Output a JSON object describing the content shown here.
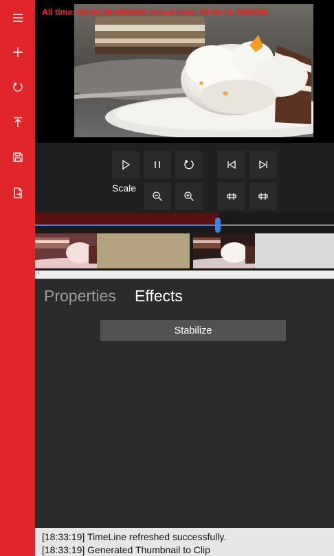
{
  "sidebar": {
    "items": [
      {
        "icon": "hamburger-menu-icon"
      },
      {
        "icon": "plus-icon"
      },
      {
        "icon": "refresh-icon"
      },
      {
        "icon": "upload-icon"
      },
      {
        "icon": "save-icon"
      },
      {
        "icon": "export-document-icon"
      }
    ],
    "color": "#e0262a"
  },
  "preview": {
    "time_readout": "All time: 00:00:29.0986666 Actual time: 00:00:16.7880000",
    "readout_color": "#ff1a1a"
  },
  "controls": {
    "scale_label": "Scale",
    "buttons": [
      {
        "icon": "play-icon"
      },
      {
        "icon": "pause-icon"
      },
      {
        "icon": "replay-icon"
      },
      {
        "icon": "skip-to-start-icon"
      },
      {
        "icon": "skip-to-end-icon"
      },
      {
        "icon": "zoom-out-icon"
      },
      {
        "icon": "zoom-in-icon"
      },
      {
        "icon": "trim-left-icon"
      },
      {
        "icon": "trim-right-icon"
      }
    ]
  },
  "timeline": {
    "playhead_fraction": 0.61,
    "progress_color": "#3a82e8",
    "clips": [
      {
        "thumbnail": "cake-thumbnail-reddish"
      },
      {
        "thumbnail": "blank-khaki"
      },
      {
        "thumbnail": "cake-thumbnail-dark"
      },
      {
        "thumbnail": "blank-light-gray"
      }
    ]
  },
  "panel": {
    "tabs": [
      {
        "label": "Properties",
        "active": false
      },
      {
        "label": "Effects",
        "active": true
      }
    ],
    "stabilize_label": "Stabilize"
  },
  "log": {
    "lines": [
      "[18:33:19] TimeLine refreshed successfully.",
      "[18:33:19] Generated Thumbnail to Clip"
    ]
  }
}
